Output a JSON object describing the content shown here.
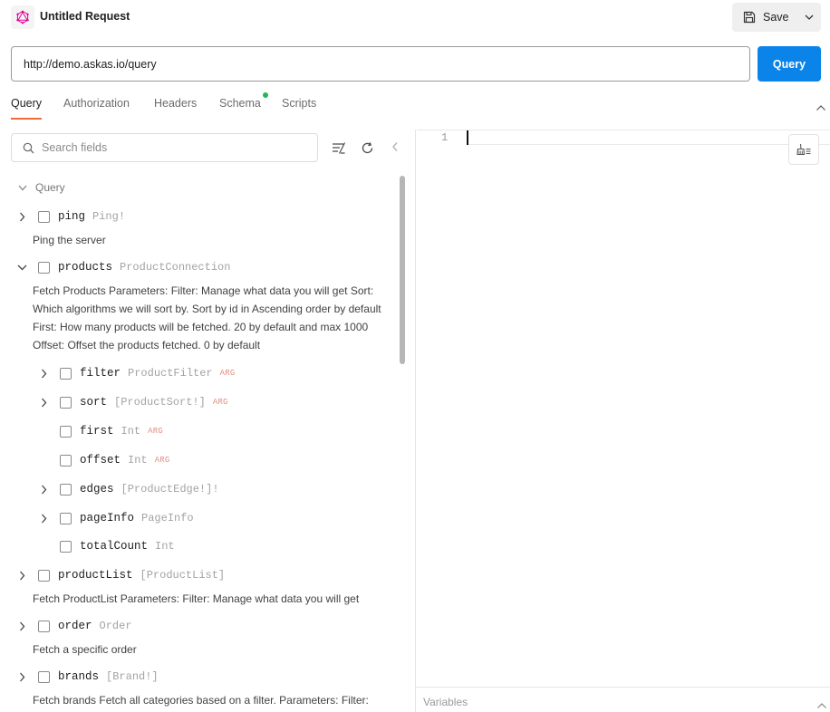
{
  "header": {
    "title": "Untitled Request",
    "save_label": "Save"
  },
  "url_bar": {
    "value": "http://demo.askas.io/query",
    "button_label": "Query"
  },
  "tabs": [
    {
      "label": "Query",
      "active": true
    },
    {
      "label": "Authorization",
      "active": false
    },
    {
      "label": "Headers",
      "active": false
    },
    {
      "label": "Schema",
      "active": false,
      "indicator_color": "#1db954"
    },
    {
      "label": "Scripts",
      "active": false
    }
  ],
  "explorer": {
    "search_placeholder": "Search fields",
    "section": "Query",
    "fields": [
      {
        "name": "ping",
        "type": "Ping!",
        "description": "Ping the server"
      },
      {
        "name": "products",
        "type": "ProductConnection",
        "description": "Fetch Products Parameters: Filter: Manage what data you will get Sort: Which algorithms we will sort by. Sort by id in Ascending order by default First: How many products will be fetched. 20 by default and max 1000 Offset: Offset the products fetched. 0 by default",
        "children": [
          {
            "name": "filter",
            "type": "ProductFilter",
            "tag": "ARG"
          },
          {
            "name": "sort",
            "type": "[ProductSort!]",
            "tag": "ARG"
          },
          {
            "name": "first",
            "type": "Int",
            "tag": "ARG"
          },
          {
            "name": "offset",
            "type": "Int",
            "tag": "ARG"
          },
          {
            "name": "edges",
            "type": "[ProductEdge!]!"
          },
          {
            "name": "pageInfo",
            "type": "PageInfo"
          },
          {
            "name": "totalCount",
            "type": "Int"
          }
        ]
      },
      {
        "name": "productList",
        "type": "[ProductList]",
        "description": "Fetch ProductList Parameters: Filter: Manage what data you will get"
      },
      {
        "name": "order",
        "type": "Order",
        "description": "Fetch a specific order"
      },
      {
        "name": "brands",
        "type": "[Brand!]",
        "description": "Fetch brands Fetch all categories based on a filter. Parameters: Filter:"
      }
    ]
  },
  "editor": {
    "line_number": "1"
  },
  "variables": {
    "label": "Variables"
  },
  "colors": {
    "accent": "#0a84e8",
    "active_tab": "#ef6c3a",
    "arg_tag": "#e38f83",
    "logo": "#e10098"
  }
}
